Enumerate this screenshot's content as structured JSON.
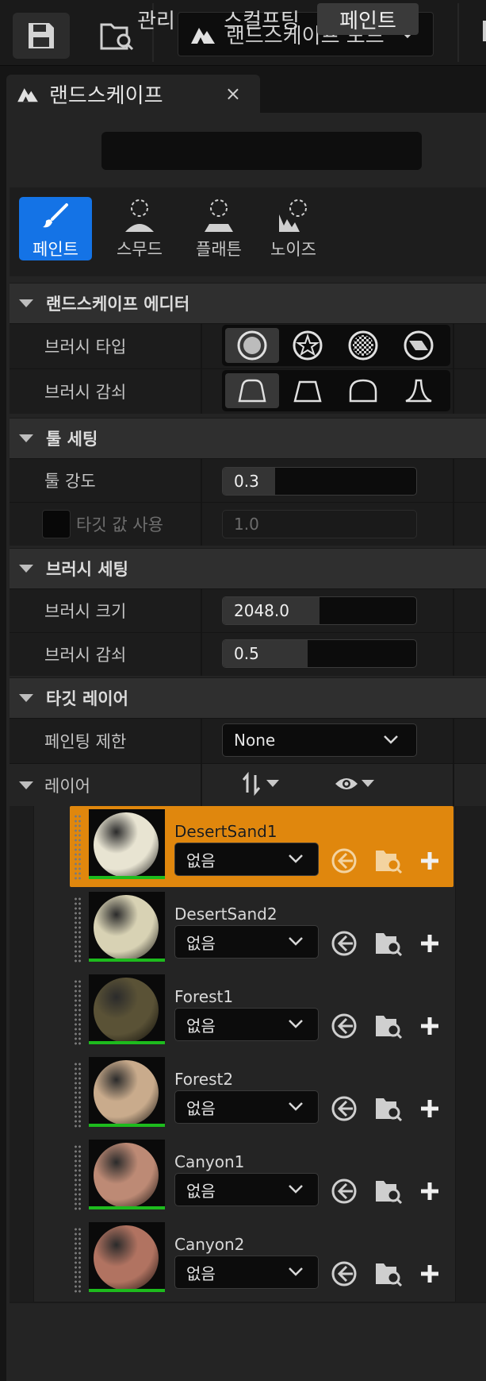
{
  "toolbar": {
    "mode_label": "랜드스케이프 모드"
  },
  "tab": {
    "title": "랜드스케이프",
    "close": "×"
  },
  "modes": [
    {
      "label": "관리"
    },
    {
      "label": "스컬프팅"
    },
    {
      "label": "페인트",
      "active": true
    }
  ],
  "tools": [
    {
      "label": "페인트",
      "active": true
    },
    {
      "label": "스무드"
    },
    {
      "label": "플래튼"
    },
    {
      "label": "노이즈"
    }
  ],
  "sections": {
    "editor": "랜드스케이프 에디터",
    "tool_settings": "툴 세팅",
    "brush_settings": "브러시 세팅",
    "target_layer": "타깃 레이어"
  },
  "editor": {
    "brush_type_label": "브러시 타입",
    "brush_falloff_label": "브러시 감쇠"
  },
  "tool_settings": {
    "strength_label": "툴 강도",
    "strength_value": "0.3",
    "strength_fraction": 0.27,
    "use_target_label": "타깃 값 사용",
    "target_value": "1.0"
  },
  "brush_settings": {
    "size_label": "브러시 크기",
    "size_value": "2048.0",
    "size_fraction": 0.5,
    "falloff_label": "브러시 감쇠",
    "falloff_value": "0.5",
    "falloff_fraction": 0.44
  },
  "target_layer": {
    "restriction_label": "페인팅 제한",
    "restriction_value": "None",
    "layers_label": "레이어"
  },
  "layers": [
    {
      "name": "DesertSand1",
      "option": "없음",
      "selected": true,
      "color": "#e8e4d2"
    },
    {
      "name": "DesertSand2",
      "option": "없음",
      "color": "#d8d2b4"
    },
    {
      "name": "Forest1",
      "option": "없음",
      "color": "#5a5236"
    },
    {
      "name": "Forest2",
      "option": "없음",
      "color": "#c9ab8c"
    },
    {
      "name": "Canyon1",
      "option": "없음",
      "color": "#bd8a75"
    },
    {
      "name": "Canyon2",
      "option": "없음",
      "color": "#b17361"
    }
  ],
  "colors": {
    "accent": "#1473e6",
    "selected_layer": "#e0870d",
    "weight_bar": "#1dbb1d"
  }
}
